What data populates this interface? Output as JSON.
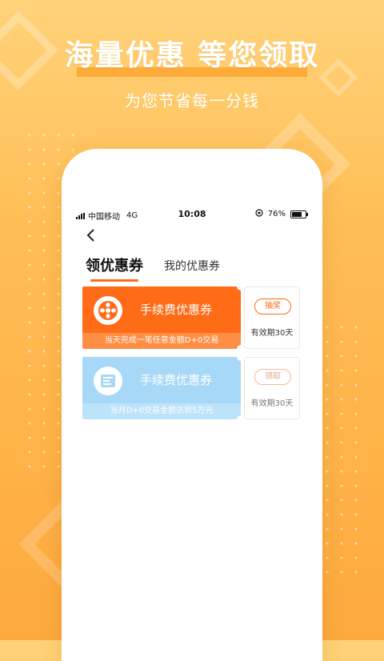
{
  "promo": {
    "headline": "海量优惠 等您领取",
    "subheadline": "为您节省每一分钱"
  },
  "status_bar": {
    "carrier": "中国移动",
    "network": "4G",
    "time": "10:08",
    "battery": "76%",
    "battery_level": 0.76
  },
  "tabs": {
    "active": "领优惠券",
    "other": "我的优惠券"
  },
  "coupons": [
    {
      "title": "手续费优惠券",
      "condition": "当天完成一笔任意金额D+0交易",
      "action_label": "抽奖",
      "validity": "有效期30天",
      "color": "#FF6B17",
      "state": "active"
    },
    {
      "title": "手续费优惠券",
      "condition": "当月D+0交易金额达到5万元",
      "action_label": "领取",
      "validity": "有效期30天",
      "color": "#A8D8F7",
      "state": "disabled"
    }
  ],
  "icons": {
    "back": "chevron-left-icon",
    "coupon1": "sun-wheel-icon",
    "coupon2": "receipt-icon"
  },
  "colors": {
    "accent": "#FF6B17",
    "background_top": "#FFD27A",
    "background_bottom": "#FDA93E"
  }
}
